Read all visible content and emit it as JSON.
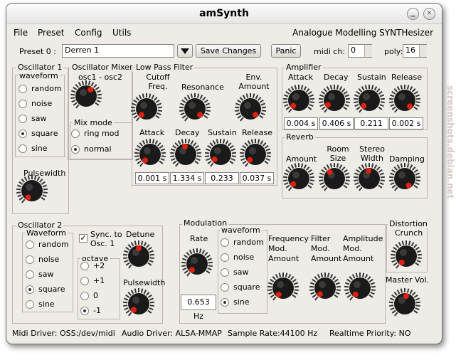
{
  "window": {
    "title": "amSynth"
  },
  "menu": {
    "file": "File",
    "preset": "Preset",
    "config": "Config",
    "utils": "Utils"
  },
  "tagline": "Analogue Modelling SYNTHesizer",
  "preset_bar": {
    "label": "Preset 0 :",
    "name": "Derren 1",
    "save_label": "Save Changes",
    "panic_label": "Panic",
    "midi_label": "midi ch:",
    "midi_value": "0",
    "poly_label": "poly:",
    "poly_value": "16"
  },
  "osc1": {
    "title": "Oscillator 1",
    "waveform_title": "waveform",
    "waveforms": [
      "random",
      "noise",
      "saw",
      "square",
      "sine"
    ],
    "selected": 3,
    "pulsewidth_label": "Pulsewidth"
  },
  "mixer": {
    "title": "Oscillator Mixer",
    "balance_label": "osc1  -  osc2",
    "mode_title": "Mix mode",
    "modes": [
      "ring mod",
      "normal"
    ],
    "selected": 1
  },
  "lpf": {
    "title": "Low Pass Filter",
    "cutoff_label": "Cutoff Freq.",
    "resonance_label": "Resonance",
    "env_label": "Env. Amount",
    "attack_label": "Attack",
    "decay_label": "Decay",
    "sustain_label": "Sustain",
    "release_label": "Release",
    "attack_value": "0.001 s",
    "decay_value": "1.334 s",
    "sustain_value": "0.233",
    "release_value": "0.037 s"
  },
  "amp": {
    "title": "Amplifier",
    "attack_label": "Attack",
    "decay_label": "Decay",
    "sustain_label": "Sustain",
    "release_label": "Release",
    "attack_value": "0.004 s",
    "decay_value": "0.406 s",
    "sustain_value": "0.211",
    "release_value": "0.002 s"
  },
  "reverb": {
    "title": "Reverb",
    "amount_label": "Amount",
    "room_label": "Room Size",
    "width_label": "Stereo Width",
    "damping_label": "Damping"
  },
  "osc2": {
    "title": "Oscillator 2",
    "waveform_title": "Waveform",
    "waveforms": [
      "random",
      "noise",
      "saw",
      "square",
      "sine"
    ],
    "selected": 3,
    "sync_label": "Sync. to Osc. 1",
    "sync_checked": "✓",
    "octave_title": "octave",
    "octaves": [
      "+2",
      "+1",
      "0",
      "-1"
    ],
    "octave_selected": 3,
    "detune_label": "Detune",
    "pulsewidth_label": "Pulsewidth"
  },
  "modulation": {
    "title": "Modulation",
    "rate_label": "Rate",
    "rate_value": "0.653 Hz",
    "waveform_title": "waveform",
    "waveforms": [
      "random",
      "noise",
      "saw",
      "square",
      "sine"
    ],
    "selected": 4,
    "freq_label": "Frequency Mod. Amount",
    "filter_label": "Filter Mod. Amount",
    "amp_label": "Amplitude Mod. Amount"
  },
  "distortion": {
    "title": "Distortion",
    "crunch_label": "Crunch"
  },
  "master": {
    "label": "Master Vol."
  },
  "status": {
    "midi": "Midi Driver: OSS:/dev/midi",
    "audio": "Audio Driver: ALSA-MMAP",
    "rate": "Sample Rate:44100 Hz",
    "priority": "Realtime Priority: NO"
  },
  "watermark": "screenshots.debian.net",
  "colors": {
    "knob_body": "#1a1a1a",
    "knob_indicator": "#e02010",
    "window_bg": "#efebe7"
  }
}
